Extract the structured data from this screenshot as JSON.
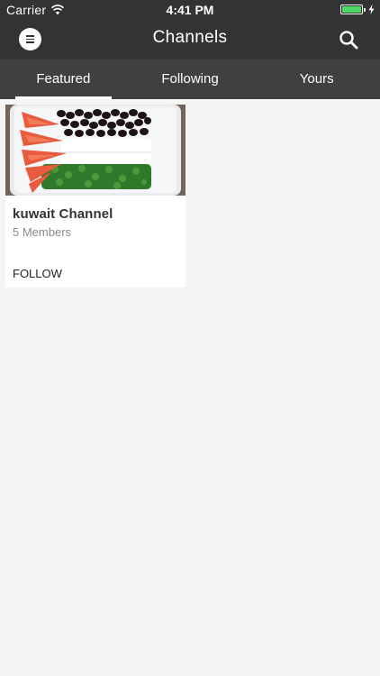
{
  "status_bar": {
    "carrier": "Carrier",
    "time": "4:41 PM",
    "battery_color": "#4cd964"
  },
  "nav": {
    "title": "Channels",
    "menu_icon": "menu-icon",
    "search_icon": "search-icon"
  },
  "tabs": [
    {
      "label": "Featured",
      "selected": true
    },
    {
      "label": "Following",
      "selected": false
    },
    {
      "label": "Yours",
      "selected": false
    }
  ],
  "channels": [
    {
      "name": "kuwait Channel",
      "members": "5 Members",
      "action": "FOLLOW"
    }
  ],
  "colors": {
    "nav_background": "#333333",
    "tab_background": "#404040",
    "page_background": "#f5f5f5"
  }
}
